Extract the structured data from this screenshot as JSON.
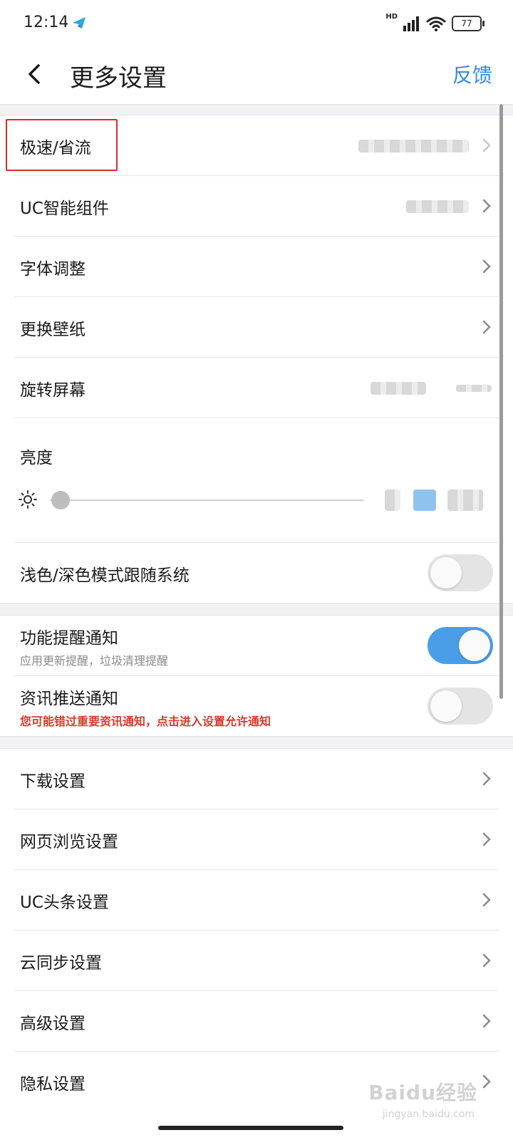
{
  "status_bar": {
    "time": "12:14",
    "network": "HD",
    "battery": "77",
    "icons": [
      "telegram-icon",
      "signal-icon",
      "wifi-icon",
      "battery-icon"
    ]
  },
  "header": {
    "title": "更多设置",
    "feedback": "反馈",
    "back_icon": "back-chevron-icon"
  },
  "colors": {
    "accent": "#2f8ceb",
    "toggle_on": "#4a9ee8",
    "warning": "#d93a2b",
    "highlight_border": "#e0282a",
    "section_gap": "#f1f2f4"
  },
  "section1": {
    "rows": [
      {
        "label": "极速/省流",
        "value": "",
        "has_chevron": true
      },
      {
        "label": "UC智能组件",
        "value": "",
        "has_chevron": true
      },
      {
        "label": "字体调整",
        "has_chevron": true
      },
      {
        "label": "更换壁纸",
        "has_chevron": true
      },
      {
        "label": "旋转屏幕",
        "value": "",
        "has_chevron": false
      }
    ],
    "brightness": {
      "label": "亮度",
      "level": 0.0
    },
    "theme_follow": {
      "label": "浅色/深色模式跟随系统",
      "enabled": false
    }
  },
  "section2": {
    "rows": [
      {
        "title": "功能提醒通知",
        "subtitle": "应用更新提醒，垃圾清理提醒",
        "enabled": true
      },
      {
        "title": "资讯推送通知",
        "subtitle": "您可能错过重要资讯通知，点击进入设置允许通知",
        "enabled": false
      }
    ]
  },
  "section3": {
    "rows": [
      {
        "label": "下载设置"
      },
      {
        "label": "网页浏览设置"
      },
      {
        "label": "UC头条设置"
      },
      {
        "label": "云同步设置"
      },
      {
        "label": "高级设置"
      },
      {
        "label": "隐私设置"
      }
    ]
  },
  "watermark": {
    "text": "Baidu经验",
    "sub": "jingyan.baidu.com"
  }
}
